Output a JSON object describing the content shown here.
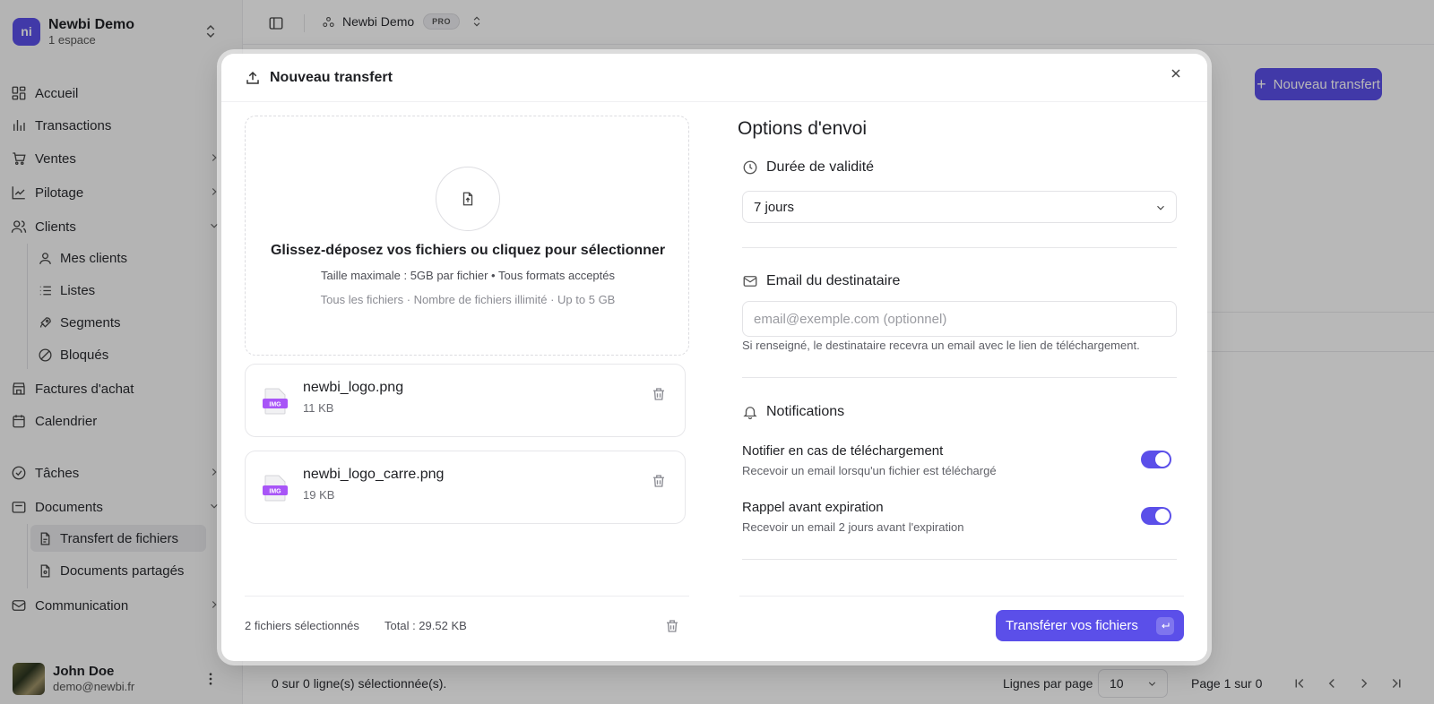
{
  "sidebar": {
    "workspace": {
      "name": "Newbi Demo",
      "subtitle": "1 espace",
      "logo_text": "ni"
    },
    "items": [
      {
        "label": "Accueil",
        "icon": "dashboard-icon"
      },
      {
        "label": "Transactions",
        "icon": "bar-chart-icon"
      },
      {
        "label": "Ventes",
        "icon": "cart-icon"
      },
      {
        "label": "Pilotage",
        "icon": "line-chart-icon"
      },
      {
        "label": "Clients",
        "icon": "users-icon"
      },
      {
        "label": "Factures d'achat",
        "icon": "store-icon"
      },
      {
        "label": "Calendrier",
        "icon": "calendar-icon"
      },
      {
        "label": "Tâches",
        "icon": "tasks-icon"
      },
      {
        "label": "Documents",
        "icon": "folder-icon"
      },
      {
        "label": "Communication",
        "icon": "mail-icon"
      }
    ],
    "clients_sub": [
      {
        "label": "Mes clients",
        "icon": "user-icon"
      },
      {
        "label": "Listes",
        "icon": "list-icon"
      },
      {
        "label": "Segments",
        "icon": "rocket-icon"
      },
      {
        "label": "Bloqués",
        "icon": "ban-icon"
      }
    ],
    "documents_sub": [
      {
        "label": "Transfert de fichiers",
        "icon": "file-icon",
        "active": true
      },
      {
        "label": "Documents partagés",
        "icon": "shared-file-icon"
      }
    ],
    "user": {
      "name": "John Doe",
      "email": "demo@newbi.fr"
    }
  },
  "topbar": {
    "workspace_name": "Newbi Demo",
    "plan_badge": "PRO"
  },
  "page": {
    "new_transfer_button": "Nouveau transfert",
    "footer": {
      "selection": "0 sur 0 ligne(s) sélectionnée(s).",
      "rows_per_page_label": "Lignes par page",
      "rows_per_page_value": "10",
      "page_label": "Page 1 sur 0"
    }
  },
  "modal": {
    "title": "Nouveau transfert",
    "dropzone": {
      "title": "Glissez-déposez vos fichiers ou cliquez pour sélectionner",
      "subtitle": "Taille maximale : 5GB par fichier • Tous formats acceptés",
      "details": "Tous les fichiers · Nombre de fichiers illimité · Up to 5 GB"
    },
    "files": [
      {
        "name": "newbi_logo.png",
        "size": "11 KB",
        "type_badge": "IMG"
      },
      {
        "name": "newbi_logo_carre.png",
        "size": "19 KB",
        "type_badge": "IMG"
      }
    ],
    "summary": {
      "count": "2 fichiers sélectionnés",
      "total": "Total : 29.52 KB"
    },
    "options": {
      "title": "Options d'envoi",
      "validity": {
        "label": "Durée de validité",
        "value": "7 jours"
      },
      "email": {
        "label": "Email du destinataire",
        "placeholder": "email@exemple.com (optionnel)",
        "value": "",
        "hint": "Si renseigné, le destinataire recevra un email avec le lien de téléchargement."
      },
      "notifications": {
        "label": "Notifications",
        "items": [
          {
            "label": "Notifier en cas de téléchargement",
            "description": "Recevoir un email lorsqu'un fichier est téléchargé",
            "enabled": true
          },
          {
            "label": "Rappel avant expiration",
            "description": "Recevoir un email 2 jours avant l'expiration",
            "enabled": true
          }
        ]
      }
    },
    "submit_label": "Transférer vos fichiers"
  },
  "colors": {
    "accent": "#5b4fe9",
    "file_badge": "#a855f7"
  }
}
